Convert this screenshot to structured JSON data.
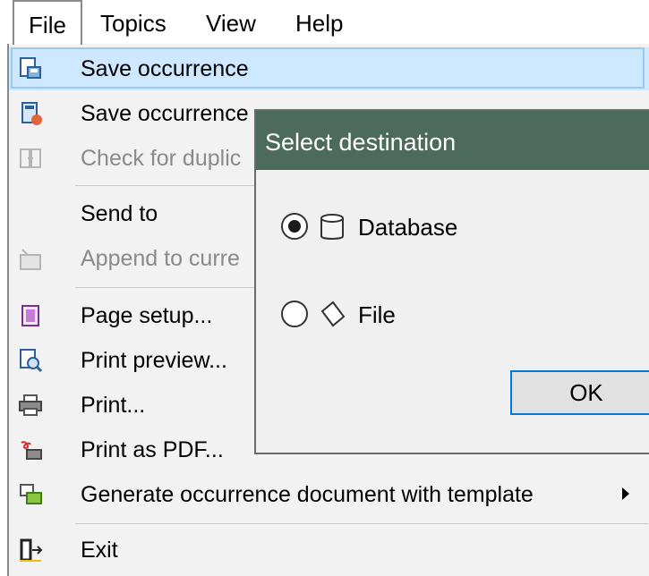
{
  "menubar": {
    "items": [
      "File",
      "Topics",
      "View",
      "Help"
    ]
  },
  "file_menu": {
    "items": [
      {
        "label": "Save occurrence",
        "icon": "save-occurrence-icon",
        "enabled": true,
        "highlighted": true
      },
      {
        "label": "Save occurrence",
        "icon": "save-occurrence-lock-icon",
        "enabled": true
      },
      {
        "label": "Check for duplic",
        "icon": "check-duplicates-icon",
        "enabled": false
      },
      {
        "label": "Send to",
        "icon": "",
        "enabled": true
      },
      {
        "label": "Append to curre",
        "icon": "append-icon",
        "enabled": false
      },
      {
        "label": "Page setup...",
        "icon": "page-setup-icon",
        "enabled": true
      },
      {
        "label": "Print preview...",
        "icon": "print-preview-icon",
        "enabled": true
      },
      {
        "label": "Print...",
        "icon": "printer-icon",
        "enabled": true
      },
      {
        "label": "Print as PDF...",
        "icon": "pdf-icon",
        "enabled": true
      },
      {
        "label": "Generate occurrence document with template",
        "icon": "generate-document-icon",
        "enabled": true,
        "submenu": true
      },
      {
        "label": "Exit",
        "icon": "exit-icon",
        "enabled": true
      }
    ]
  },
  "dialog": {
    "title": "Select destination",
    "options": [
      {
        "label": "Database",
        "icon": "database-icon",
        "selected": true
      },
      {
        "label": "File",
        "icon": "file-icon",
        "selected": false
      }
    ],
    "ok_label": "OK"
  },
  "colors": {
    "highlight": "#cde8ff",
    "dialog_titlebar": "#4d6b5c",
    "ok_border": "#0078d7"
  }
}
